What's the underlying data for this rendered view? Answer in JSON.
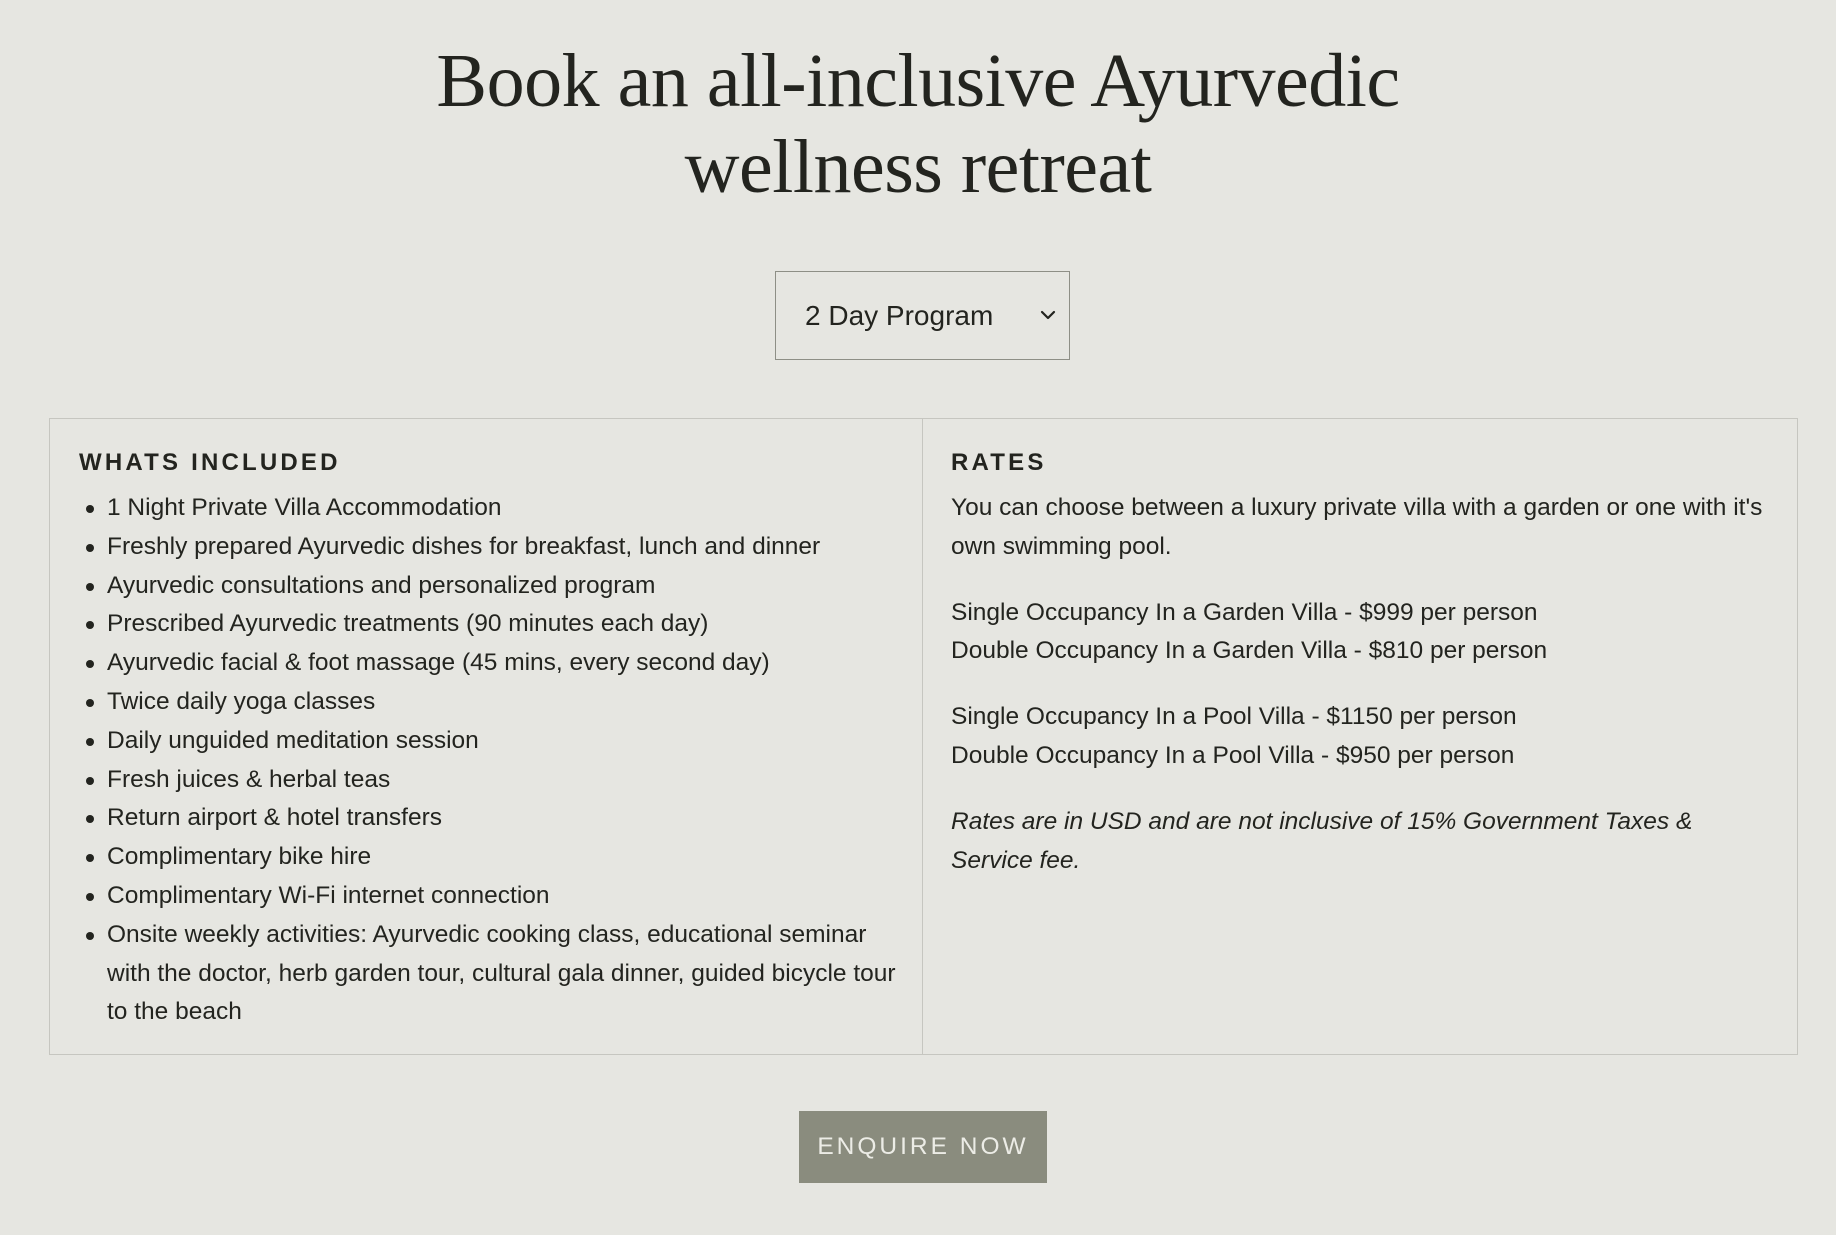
{
  "page": {
    "title_line1": "Book an all-inclusive Ayurvedic",
    "title_line2": "wellness retreat"
  },
  "program_select": {
    "selected": "2 Day Program",
    "icon": "chevron-down-icon"
  },
  "included": {
    "heading": "WHATS INCLUDED",
    "items": [
      "1 Night Private Villa Accommodation",
      "Freshly prepared Ayurvedic dishes for breakfast, lunch and dinner",
      "Ayurvedic consultations and personalized program",
      "Prescribed Ayurvedic treatments (90 minutes each day)",
      "Ayurvedic facial & foot massage (45 mins, every second day)",
      "Twice daily yoga classes",
      "Daily unguided meditation session",
      "Fresh juices & herbal teas",
      "Return airport & hotel transfers",
      "Complimentary bike hire",
      "Complimentary Wi-Fi internet connection",
      "Onsite weekly activities: Ayurvedic cooking class, educational seminar with the doctor, herb garden tour, cultural gala dinner, guided bicycle tour to the beach"
    ]
  },
  "rates": {
    "heading": "RATES",
    "intro": "You can choose between a luxury private villa with a garden or one with it's own swimming pool.",
    "garden_single": "Single Occupancy In a Garden Villa - $999 per person",
    "garden_double": "Double Occupancy In a Garden Villa - $810 per person",
    "pool_single": "Single Occupancy In a Pool Villa - $1150 per person",
    "pool_double": "Double Occupancy In a Pool Villa - $950 per person",
    "note": "Rates are in USD and are not inclusive of 15% Government Taxes & Service fee."
  },
  "cta": {
    "label": "ENQUIRE NOW"
  },
  "colors": {
    "background": "#e6e6e1",
    "text": "#23241f",
    "border": "#c6c6c0",
    "button_bg": "#8a8c7e",
    "button_text": "#ecece6"
  }
}
